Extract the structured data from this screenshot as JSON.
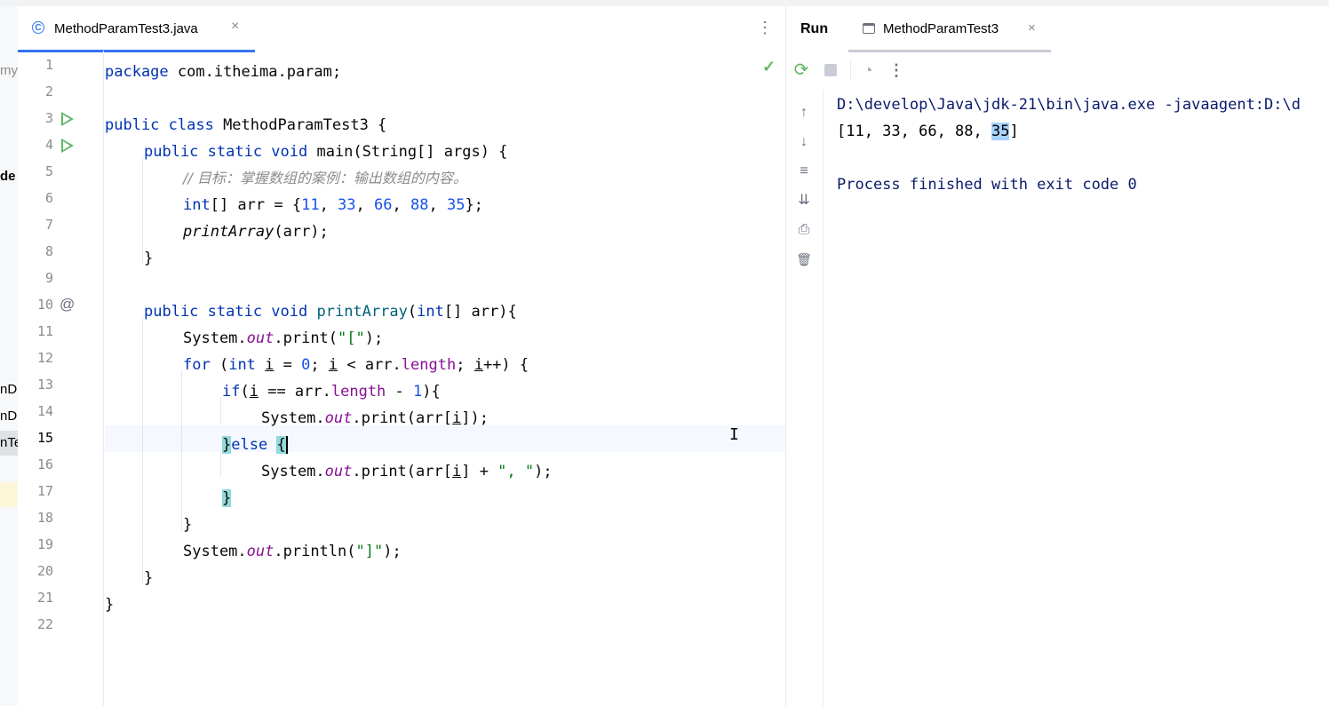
{
  "editor": {
    "tab": {
      "title": "MethodParamTest3.java",
      "close": "×"
    },
    "more": "⋮",
    "inspection_ok": "✓",
    "lines": {
      "n1": "1",
      "n2": "2",
      "n3": "3",
      "n4": "4",
      "n5": "5",
      "n6": "6",
      "n7": "7",
      "n8": "8",
      "n9": "9",
      "n10": "10",
      "n11": "11",
      "n12": "12",
      "n13": "13",
      "n14": "14",
      "n15": "15",
      "n16": "16",
      "n17": "17",
      "n18": "18",
      "n19": "19",
      "n20": "20",
      "n21": "21",
      "n22": "22"
    },
    "code": {
      "l1_kw": "package",
      "l1_rest": " com.itheima.param;",
      "l3_kw": "public class",
      "l3_rest": " MethodParamTest3 {",
      "l4_kw": "public static void",
      "l4_rest": " main(String[] args) {",
      "l5_comment": "// 目标：掌握数组的案例：输出数组的内容。",
      "l6_kw": "int",
      "l6_a": "[] arr = {",
      "l6_n1": "11",
      "l6_n2": "33",
      "l6_n3": "66",
      "l6_n4": "88",
      "l6_n5": "35",
      "l6_end": "};",
      "l7_call": "printArray",
      "l7_rest": "(arr);",
      "l8": "}",
      "l10_kw": "public static void",
      "l10_name": "printArray",
      "l10_p": "(",
      "l10_kw2": "int",
      "l10_rest": "[] arr){",
      "l11_a": "System.",
      "l11_out": "out",
      "l11_b": ".print(",
      "l11_str": "\"[\"",
      "l11_c": ");",
      "l12_kw": "for",
      "l12_a": " (",
      "l12_kw2": "int",
      "l12_i": "i",
      "l12_b": " = ",
      "l12_zero": "0",
      "l12_c": "; ",
      "l12_i2": "i",
      "l12_d": " < arr.",
      "l12_len": "length",
      "l12_e": "; ",
      "l12_i3": "i",
      "l12_f": "++) {",
      "l13_kw": "if",
      "l13_a": "(",
      "l13_i": "i",
      "l13_b": " == arr.",
      "l13_len": "length",
      "l13_c": " - ",
      "l13_one": "1",
      "l13_d": "){",
      "l14_a": "System.",
      "l14_out": "out",
      "l14_b": ".print(arr[",
      "l14_i": "i",
      "l14_c": "]);",
      "l15_brace": "}",
      "l15_kw": "else",
      "l15_open": "{",
      "l16_a": "System.",
      "l16_out": "out",
      "l16_b": ".print(arr[",
      "l16_i": "i",
      "l16_c": "] + ",
      "l16_str": "\", \"",
      "l16_d": ");",
      "l17": "}",
      "l18": "}",
      "l19_a": "System.",
      "l19_out": "out",
      "l19_b": ".println(",
      "l19_str": "\"]\"",
      "l19_c": ");",
      "l20": "}",
      "l21": "}"
    }
  },
  "left_panel": {
    "a": "my",
    "b": "de",
    "c": "nD",
    "d": "nD",
    "e": "nTe"
  },
  "run": {
    "label": "Run",
    "tab": {
      "title": "MethodParamTest3",
      "close": "×"
    },
    "toolbar": {
      "rerun": "⟳",
      "perf": "◔",
      "more": "⋮"
    },
    "side": {
      "up": "↑",
      "down": "↓",
      "wrap": "≡",
      "scroll_end": "⇊",
      "print": "⎙",
      "clear": "🗑"
    },
    "console": {
      "cmd": "D:\\develop\\Java\\jdk-21\\bin\\java.exe -javaagent:D:\\d",
      "out_a": "[11, 33, 66, 88, ",
      "out_sel": "35",
      "out_b": "]",
      "finished": "Process finished with exit code 0"
    }
  },
  "colors": {
    "accent": "#3574f0",
    "keyword": "#0033b3",
    "number": "#1750eb",
    "string": "#067d17",
    "field": "#871094",
    "run_green": "#5fb865"
  }
}
